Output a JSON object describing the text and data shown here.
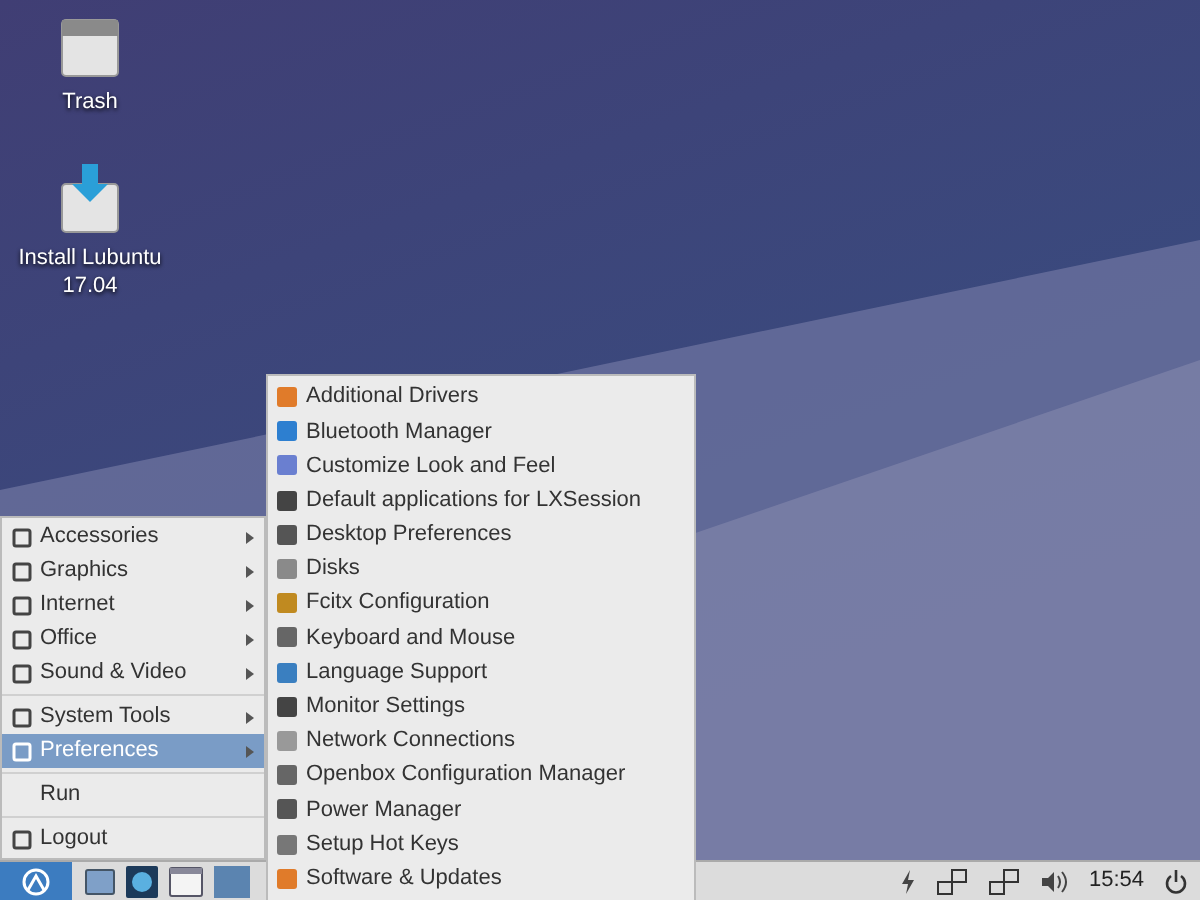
{
  "desktop_icons": [
    {
      "label": "Trash",
      "kind": "trash"
    },
    {
      "label": "Install Lubuntu 17.04",
      "kind": "install"
    }
  ],
  "main_menu": {
    "groups": [
      [
        {
          "label": "Accessories",
          "submenu": true,
          "selected": false
        },
        {
          "label": "Graphics",
          "submenu": true,
          "selected": false
        },
        {
          "label": "Internet",
          "submenu": true,
          "selected": false
        },
        {
          "label": "Office",
          "submenu": true,
          "selected": false
        },
        {
          "label": "Sound & Video",
          "submenu": true,
          "selected": false
        }
      ],
      [
        {
          "label": "System Tools",
          "submenu": true,
          "selected": false
        },
        {
          "label": "Preferences",
          "submenu": true,
          "selected": true
        }
      ],
      [
        {
          "label": "Run",
          "submenu": false,
          "selected": false
        }
      ],
      [
        {
          "label": "Logout",
          "submenu": false,
          "selected": false
        }
      ]
    ]
  },
  "submenu": {
    "items": [
      {
        "label": "Additional Drivers"
      },
      {
        "label": "Bluetooth Manager"
      },
      {
        "label": "Customize Look and Feel"
      },
      {
        "label": "Default applications for LXSession"
      },
      {
        "label": "Desktop Preferences"
      },
      {
        "label": "Disks"
      },
      {
        "label": "Fcitx Configuration"
      },
      {
        "label": "Keyboard and Mouse"
      },
      {
        "label": "Language Support"
      },
      {
        "label": "Monitor Settings"
      },
      {
        "label": "Network Connections"
      },
      {
        "label": "Openbox Configuration Manager"
      },
      {
        "label": "Power Manager"
      },
      {
        "label": "Setup Hot Keys"
      },
      {
        "label": "Software & Updates"
      }
    ]
  },
  "taskbar": {
    "clock": "15:54"
  }
}
